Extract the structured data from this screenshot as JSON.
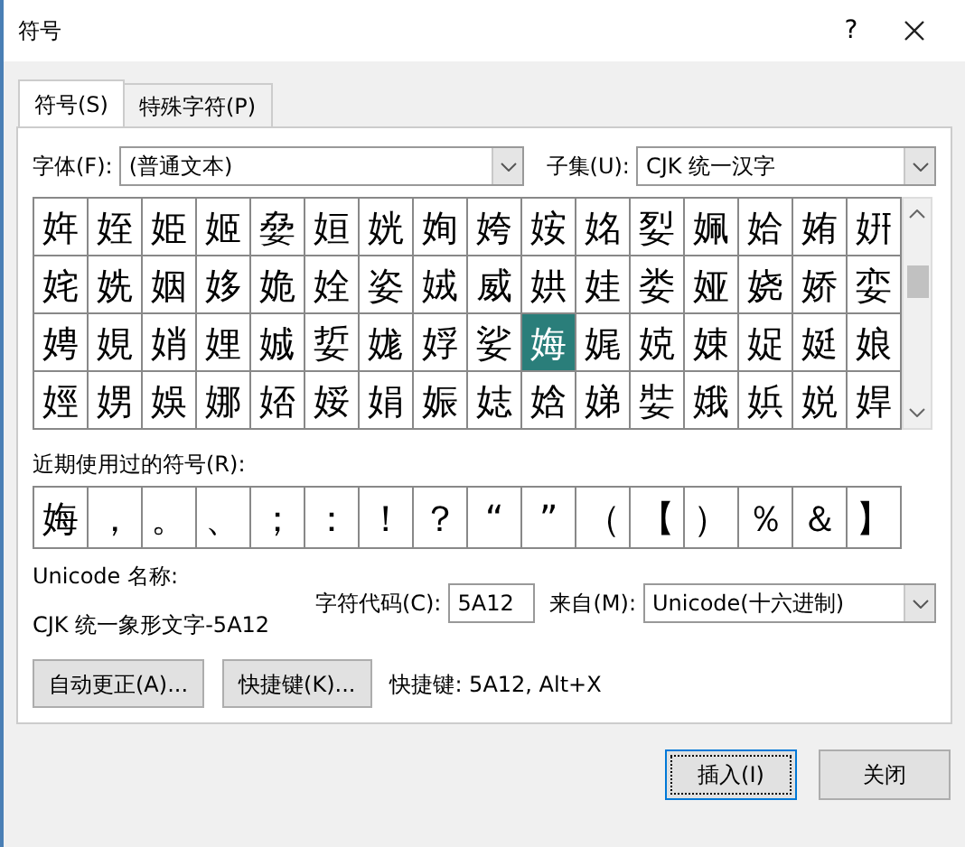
{
  "window": {
    "title": "符号",
    "help": "?"
  },
  "tabs": [
    {
      "label": "符号(S)",
      "selected": true
    },
    {
      "label": "特殊字符(P)",
      "selected": false
    }
  ],
  "font": {
    "label": "字体(F):",
    "value": "(普通文本)"
  },
  "subset": {
    "label": "子集(U):",
    "value": "CJK 统一汉字"
  },
  "grid": [
    {
      "char": "姩",
      "selected": false
    },
    {
      "char": "姪",
      "selected": false
    },
    {
      "char": "姫",
      "selected": false
    },
    {
      "char": "姬",
      "selected": false
    },
    {
      "char": "姭",
      "selected": false
    },
    {
      "char": "姮",
      "selected": false
    },
    {
      "char": "姯",
      "selected": false
    },
    {
      "char": "姰",
      "selected": false
    },
    {
      "char": "姱",
      "selected": false
    },
    {
      "char": "姲",
      "selected": false
    },
    {
      "char": "姳",
      "selected": false
    },
    {
      "char": "姴",
      "selected": false
    },
    {
      "char": "姵",
      "selected": false
    },
    {
      "char": "姶",
      "selected": false
    },
    {
      "char": "姷",
      "selected": false
    },
    {
      "char": "姸",
      "selected": false
    },
    {
      "char": "姹",
      "selected": false
    },
    {
      "char": "姺",
      "selected": false
    },
    {
      "char": "姻",
      "selected": false
    },
    {
      "char": "姼",
      "selected": false
    },
    {
      "char": "姽",
      "selected": false
    },
    {
      "char": "姾",
      "selected": false
    },
    {
      "char": "姿",
      "selected": false
    },
    {
      "char": "娀",
      "selected": false
    },
    {
      "char": "威",
      "selected": false
    },
    {
      "char": "娂",
      "selected": false
    },
    {
      "char": "娃",
      "selected": false
    },
    {
      "char": "娄",
      "selected": false
    },
    {
      "char": "娅",
      "selected": false
    },
    {
      "char": "娆",
      "selected": false
    },
    {
      "char": "娇",
      "selected": false
    },
    {
      "char": "娈",
      "selected": false
    },
    {
      "char": "娉",
      "selected": false
    },
    {
      "char": "娊",
      "selected": false
    },
    {
      "char": "娋",
      "selected": false
    },
    {
      "char": "娌",
      "selected": false
    },
    {
      "char": "娍",
      "selected": false
    },
    {
      "char": "娎",
      "selected": false
    },
    {
      "char": "娏",
      "selected": false
    },
    {
      "char": "娐",
      "selected": false
    },
    {
      "char": "娑",
      "selected": false
    },
    {
      "char": "娒",
      "selected": true
    },
    {
      "char": "娓",
      "selected": false
    },
    {
      "char": "娔",
      "selected": false
    },
    {
      "char": "娕",
      "selected": false
    },
    {
      "char": "娖",
      "selected": false
    },
    {
      "char": "娗",
      "selected": false
    },
    {
      "char": "娘",
      "selected": false
    },
    {
      "char": "娙",
      "selected": false
    },
    {
      "char": "娚",
      "selected": false
    },
    {
      "char": "娛",
      "selected": false
    },
    {
      "char": "娜",
      "selected": false
    },
    {
      "char": "娝",
      "selected": false
    },
    {
      "char": "娞",
      "selected": false
    },
    {
      "char": "娟",
      "selected": false
    },
    {
      "char": "娠",
      "selected": false
    },
    {
      "char": "娡",
      "selected": false
    },
    {
      "char": "娢",
      "selected": false
    },
    {
      "char": "娣",
      "selected": false
    },
    {
      "char": "娤",
      "selected": false
    },
    {
      "char": "娥",
      "selected": false
    },
    {
      "char": "娦",
      "selected": false
    },
    {
      "char": "娧",
      "selected": false
    },
    {
      "char": "娨",
      "selected": false
    }
  ],
  "recent": {
    "label": "近期使用过的符号(R):",
    "symbols": [
      "娒",
      "，",
      "。",
      "、",
      "；",
      "：",
      "！",
      "？",
      "“",
      "”",
      "（",
      "【",
      "）",
      "％",
      "＆",
      "】"
    ]
  },
  "unicode_name": {
    "label": "Unicode 名称:",
    "value": "CJK 统一象形文字-5A12"
  },
  "char_code": {
    "label": "字符代码(C):",
    "value": "5A12"
  },
  "from": {
    "label": "来自(M):",
    "value": "Unicode(十六进制)"
  },
  "buttons": [
    {
      "label": "自动更正(A)..."
    },
    {
      "label": "快捷键(K)..."
    }
  ],
  "shortcut": "快捷键: 5A12, Alt+X",
  "footer": [
    {
      "label": "插入(I)",
      "selected": true
    },
    {
      "label": "关闭",
      "selected": false
    }
  ]
}
